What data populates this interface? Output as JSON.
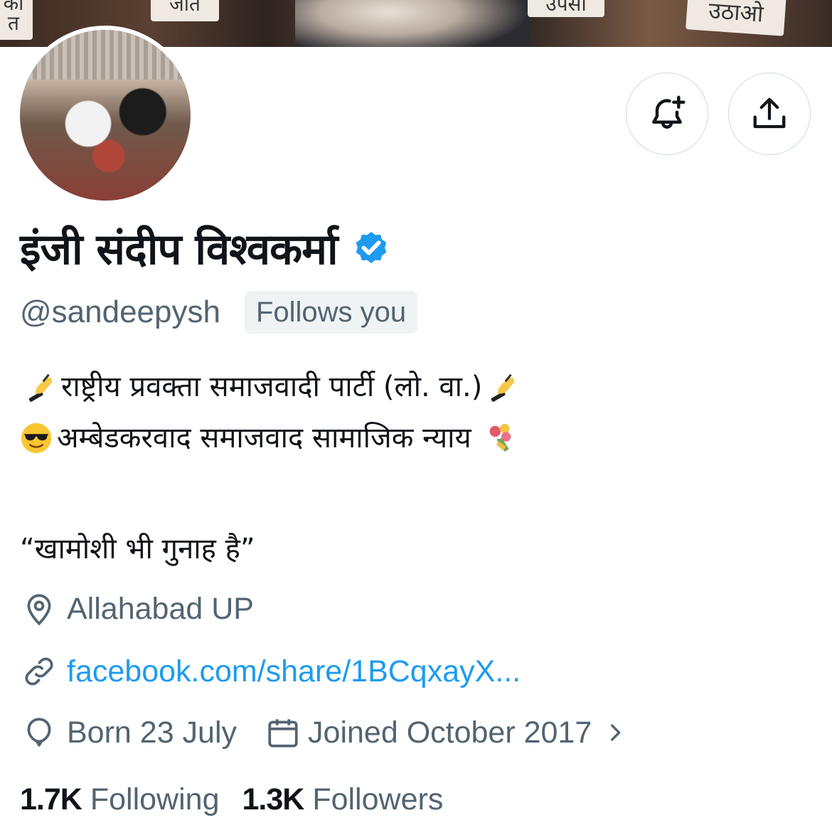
{
  "banner": {
    "signs": [
      "का",
      "त",
      "जात",
      "उपसा",
      "उठाओ"
    ]
  },
  "profile": {
    "display_name": "इंजी संदीप विश्वकर्मा",
    "handle": "@sandeepysh",
    "follows_you_label": "Follows you",
    "bio_line1": "राष्ट्रीय प्रवक्ता समाजवादी पार्टी (लो. वा.)",
    "bio_line2": "अम्बेडकरवाद समाजवाद सामाजिक न्याय",
    "bio_quote": "“खामोशी भी गुनाह है”",
    "location": "Allahabad UP",
    "website": "facebook.com/share/1BCqxayX...",
    "birthday": "Born 23 July",
    "joined": "Joined October 2017"
  },
  "stats": {
    "following_count": "1.7K",
    "following_label": "Following",
    "followers_count": "1.3K",
    "followers_label": "Followers"
  },
  "icons": {
    "notify": "bell-plus-icon",
    "share": "share-icon",
    "verified": "verified-badge-icon",
    "location": "location-pin-icon",
    "link": "link-icon",
    "birthday": "balloon-icon",
    "joined": "calendar-icon",
    "chevron": "chevron-right-icon"
  },
  "colors": {
    "accent": "#1d9bf0",
    "secondary_text": "#536471",
    "primary_text": "#0f1419",
    "border": "#cfd9de"
  }
}
